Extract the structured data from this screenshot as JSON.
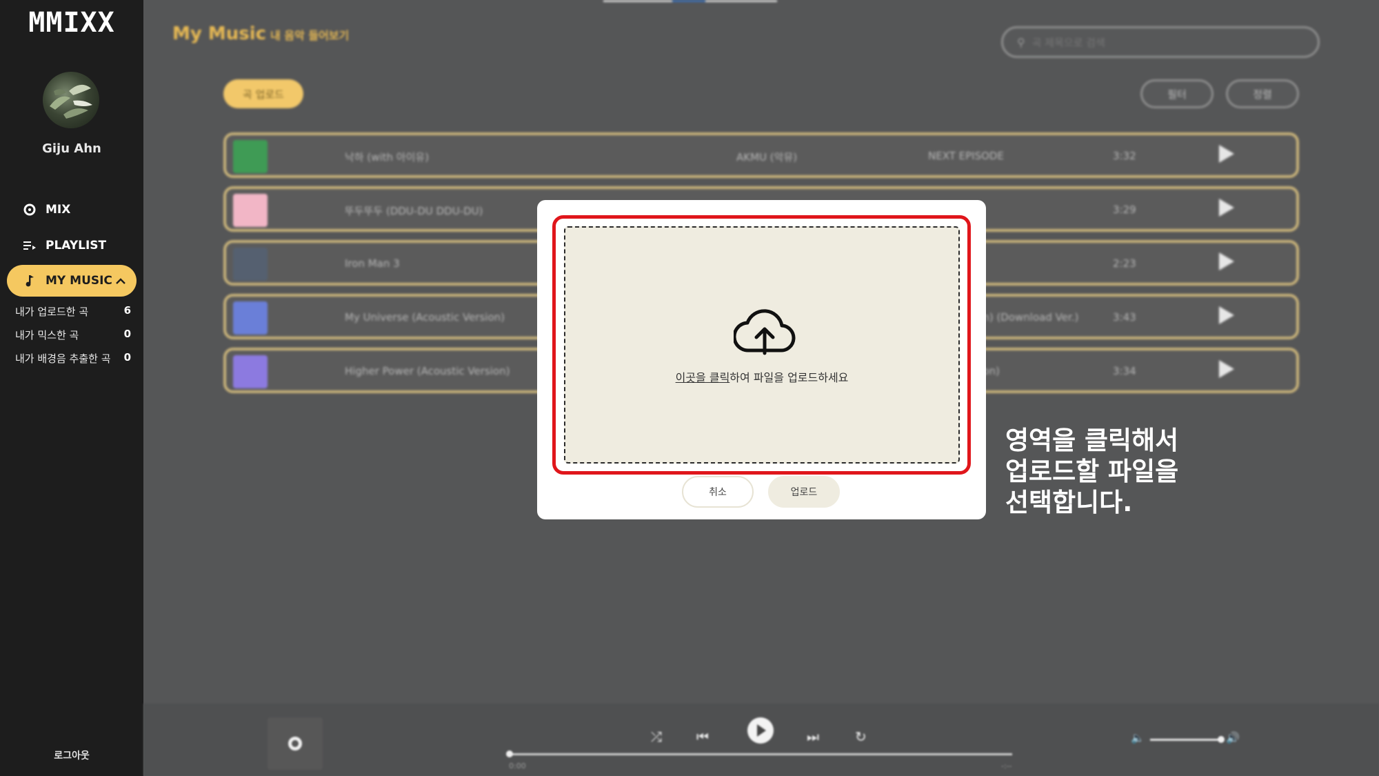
{
  "app": {
    "logo": "MMIXX"
  },
  "sidebar": {
    "username": "Giju Ahn",
    "nav": [
      {
        "label": "MIX",
        "icon": "disc-icon"
      },
      {
        "label": "PLAYLIST",
        "icon": "playlist-icon"
      },
      {
        "label": "MY MUSIC",
        "icon": "music-note-icon",
        "expanded": true
      }
    ],
    "sub_items": [
      {
        "label": "내가 업로드한 곡",
        "count": "6"
      },
      {
        "label": "내가 믹스한 곡",
        "count": "0"
      },
      {
        "label": "내가 배경음 추출한 곡",
        "count": "0"
      }
    ],
    "logout": "로그아웃"
  },
  "main": {
    "title": "My Music",
    "subtitle": "내 음악 들어보기",
    "search_placeholder": "곡 제목으로 검색",
    "upload_button": "곡 업로드",
    "filter_button": "필터",
    "sort_button": "정렬",
    "tracks": [
      {
        "title": "낙하 (with 아이유)",
        "artist": "AKMU (악뮤)",
        "album": "NEXT EPISODE",
        "duration": "3:32",
        "art_color": "#3f9b55"
      },
      {
        "title": "뚜두뚜두 (DDU-DU DDU-DU)",
        "artist": "",
        "album": "",
        "duration": "3:29",
        "art_color": "#f2b6c6"
      },
      {
        "title": "Iron Man 3",
        "artist": "",
        "album": "",
        "duration": "2:23",
        "art_color": "#556070"
      },
      {
        "title": "My Universe (Acoustic Version)",
        "artist": "",
        "album": "rsion) (Download Ver.)",
        "duration": "3:43",
        "art_color": "#6a7fd8"
      },
      {
        "title": "Higher Power (Acoustic Version)",
        "artist": "",
        "album": "ersion)",
        "duration": "3:34",
        "art_color": "#8c7ae0"
      }
    ]
  },
  "player": {
    "time_current": "0:00",
    "time_total": "-:--",
    "volume": 0.8
  },
  "modal": {
    "dropzone_link": "이곳을 클릭",
    "dropzone_text": "하여 파일을 업로드하세요",
    "cancel_button": "취소",
    "upload_button": "업로드"
  },
  "annotation": "영역을 클릭해서\n업로드할 파일을\n선택합니다.",
  "colors": {
    "accent": "#f5c860",
    "highlight": "#e0161b",
    "sidebar_bg": "#1d1d1d"
  }
}
